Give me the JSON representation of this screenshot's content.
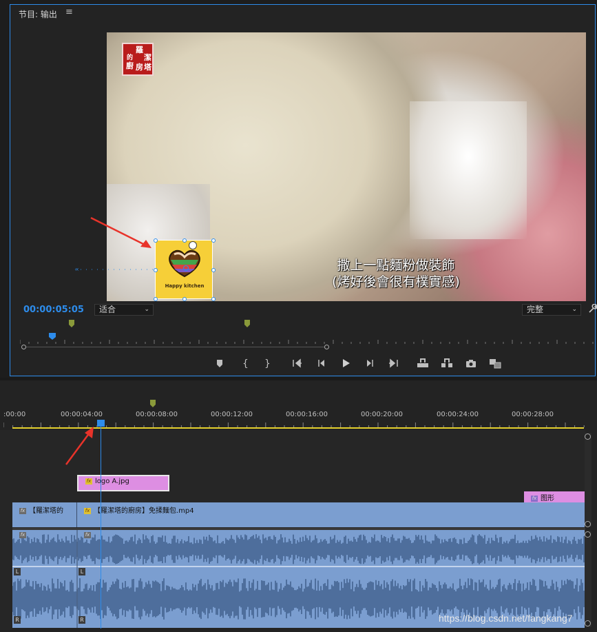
{
  "monitor": {
    "title": "节目: 输出",
    "menu_icon": "≡",
    "timecode": "00:00:05:05",
    "zoom": "适合",
    "quality": "完整",
    "video": {
      "seal_chars": [
        "羅",
        "潔",
        "塔",
        "的",
        "廚",
        "房"
      ],
      "caption_line1": "撒上一點麵粉做裝飾",
      "caption_line2": "(烤好後會很有樸實感)",
      "logo_text": "Happy kitchen"
    },
    "transport_buttons": [
      "marker-icon",
      "mark-in-icon",
      "mark-out-icon",
      "go-to-in-icon",
      "step-back-icon",
      "play-icon",
      "step-forward-icon",
      "go-to-out-icon",
      "lift-icon",
      "extract-icon",
      "export-frame-icon",
      "compare-icon"
    ]
  },
  "timeline": {
    "time_labels": [
      ":00:00",
      "00:00:04:00",
      "00:00:08:00",
      "00:00:12:00",
      "00:00:16:00",
      "00:00:20:00",
      "00:00:24:00",
      "00:00:28:00"
    ],
    "clips": {
      "v3_logo": "logo A.jpg",
      "v2_graphic": "图形",
      "v1_a": "【羅潔塔的",
      "v1_b": "【羅潔塔的廚房】免揉麵包.mp4"
    },
    "audio_channels": [
      "L",
      "R"
    ]
  },
  "watermark": "https://blog.csdn.net/fangkang7",
  "colors": {
    "accent": "#2d8ceb",
    "clip_video": "#7b9ed0",
    "clip_graphic": "#dd8ee2",
    "work_area": "#e5d12c",
    "annotation": "#e8332a"
  }
}
